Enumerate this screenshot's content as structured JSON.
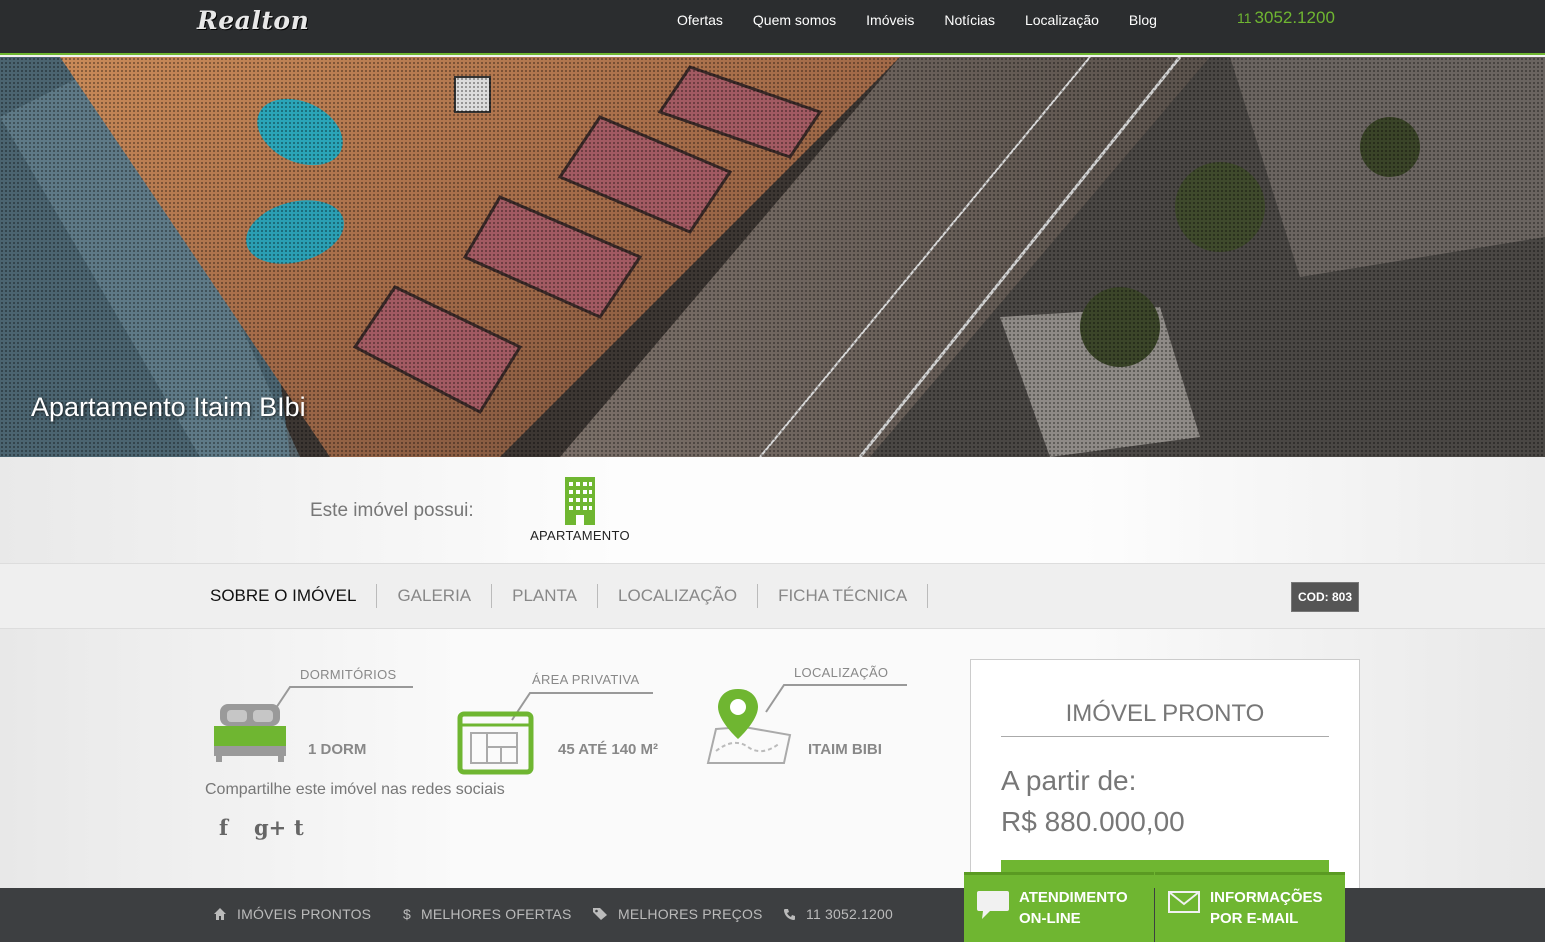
{
  "brand": {
    "logo_text": "Realton"
  },
  "nav": {
    "items": [
      "Ofertas",
      "Quem somos",
      "Imóveis",
      "Notícias",
      "Localização",
      "Blog"
    ],
    "phone_ddd": "11",
    "phone_number": "3052.1200"
  },
  "hero": {
    "title": "Apartamento Itaim BIbi"
  },
  "features": {
    "label": "Este imóvel possui:",
    "items": [
      {
        "label": "APARTAMENTO",
        "icon": "building-icon"
      }
    ]
  },
  "tabs": {
    "items": [
      "SOBRE O IMÓVEL",
      "GALERIA",
      "PLANTA",
      "LOCALIZAÇÃO",
      "FICHA TÉCNICA"
    ],
    "active": "SOBRE O IMÓVEL",
    "cod": "COD: 803"
  },
  "specs": {
    "dorm_head": "DORMITÓRIOS",
    "dorm_val": "1 DORM",
    "area_head": "ÁREA PRIVATIVA",
    "area_val": "45 ATÉ 140 M²",
    "loc_head": "LOCALIZAÇÃO",
    "loc_val": "ITAIM BIBI"
  },
  "share": {
    "label": "Compartilhe este imóvel nas redes sociais",
    "facebook": "f",
    "googleplus": "g+",
    "twitter": "t"
  },
  "price": {
    "status": "IMÓVEL PRONTO",
    "from_label": "A partir de:",
    "value": "R$ 880.000,00"
  },
  "bottom": {
    "items": [
      {
        "label": "IMÓVEIS PRONTOS",
        "icon": "home-icon"
      },
      {
        "label": "MELHORES OFERTAS",
        "icon": "dollar-icon"
      },
      {
        "label": "MELHORES PREÇOS",
        "icon": "tag-icon"
      },
      {
        "label": "11 3052.1200",
        "icon": "phone-icon"
      }
    ]
  },
  "cta": {
    "online_line1": "ATENDIMENTO",
    "online_line2": "ON-LINE",
    "mail_line1": "INFORMAÇÕES",
    "mail_line2": "POR E-MAIL"
  },
  "colors": {
    "accent": "#6fb631",
    "topbar": "#2b2d2f",
    "bottombar": "#3d3f41"
  }
}
